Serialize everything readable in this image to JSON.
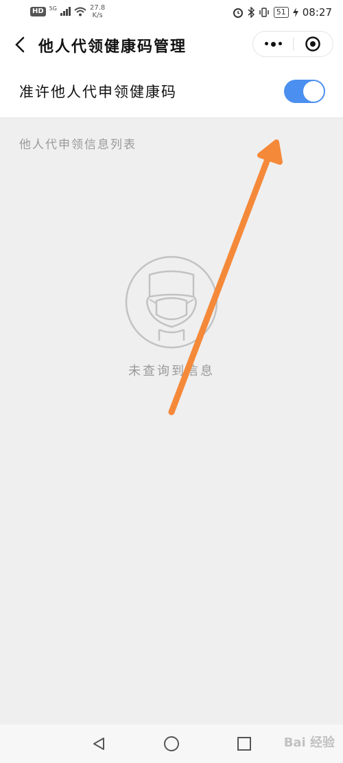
{
  "status_bar": {
    "hd": "HD",
    "signal": "5G",
    "speed_value": "27.8",
    "speed_unit": "K/s",
    "battery": "51",
    "time": "08:27"
  },
  "header": {
    "title": "他人代领健康码管理",
    "back_icon": "chevron-left-icon",
    "more_icon": "more-dots-icon",
    "close_icon": "target-close-icon"
  },
  "settings": {
    "allow_label": "准许他人代申领健康码",
    "allow_enabled": true,
    "switch_color": "#4b8ff0"
  },
  "list": {
    "section_title": "他人代申领信息列表",
    "empty_text": "未查询到信息",
    "empty_icon": "person-avatar-icon"
  },
  "annotation": {
    "arrow_color": "#f5893a"
  },
  "nav": {
    "back_icon": "triangle-back-icon",
    "home_icon": "circle-home-icon",
    "recent_icon": "square-recent-icon"
  },
  "watermark": "Bai 经验"
}
